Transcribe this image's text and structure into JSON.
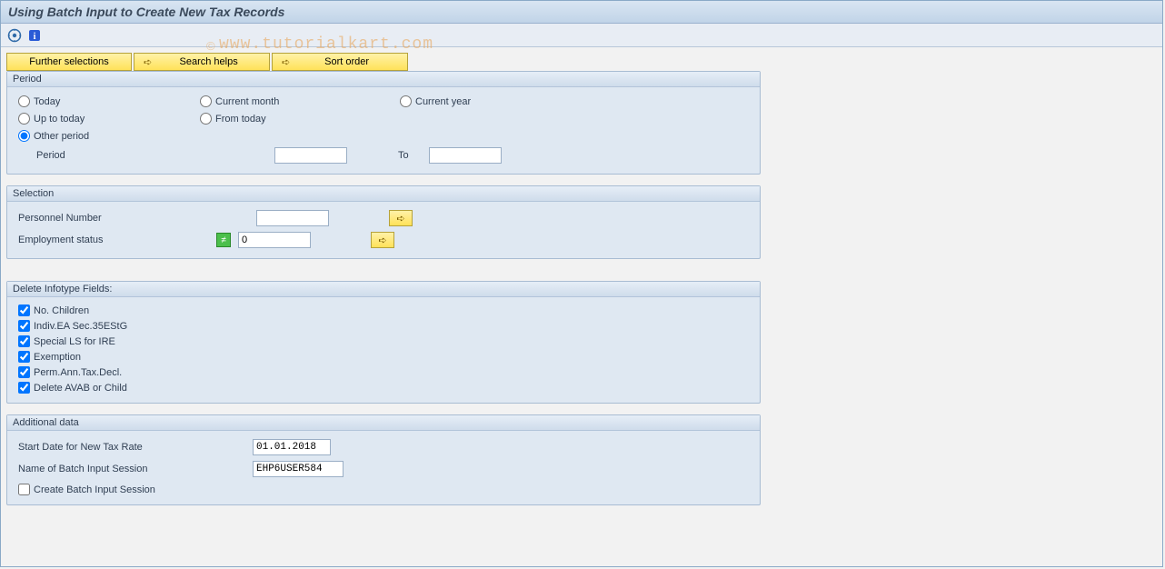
{
  "title": "Using Batch Input to Create New Tax Records",
  "watermark": {
    "copy": "©",
    "text": "www.tutorialkart.com"
  },
  "toolbar": {
    "further_selections": "Further selections",
    "search_helps": "Search helps",
    "sort_order": "Sort order"
  },
  "period": {
    "title": "Period",
    "today": "Today",
    "current_month": "Current month",
    "current_year": "Current year",
    "up_to_today": "Up to today",
    "from_today": "From today",
    "other_period": "Other period",
    "period_label": "Period",
    "to_label": "To",
    "period_from_value": "",
    "period_to_value": ""
  },
  "selection": {
    "title": "Selection",
    "personnel_number_label": "Personnel Number",
    "personnel_number_value": "",
    "employment_status_label": "Employment status",
    "employment_status_value": "0"
  },
  "delete_fields": {
    "title": "Delete Infotype Fields:",
    "no_children": "No. Children",
    "indiv_ea": "Indiv.EA Sec.35EStG",
    "special_ls": "Special LS for IRE",
    "exemption": "Exemption",
    "perm_ann": "Perm.Ann.Tax.Decl.",
    "delete_avab": "Delete AVAB or Child"
  },
  "additional": {
    "title": "Additional data",
    "start_date_label": "Start Date for New Tax Rate",
    "start_date_value": "01.01.2018",
    "session_name_label": "Name of Batch Input Session",
    "session_name_value": "EHP6USER584",
    "create_session": "Create Batch Input Session"
  }
}
